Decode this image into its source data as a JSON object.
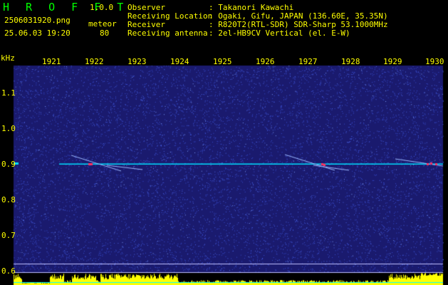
{
  "header": {
    "logo": "H R O F F T",
    "version": "1.0.0",
    "filename": "2506031920.png",
    "timestamp": "25.06.03 19:20",
    "meteor_label": "meteor",
    "meteor_count": "80",
    "info": [
      {
        "key": "Observer",
        "value": "Takanori Kawachi"
      },
      {
        "key": "Receiving Location",
        "value": "Ogaki, Gifu, JAPAN (136.60E, 35.35N)"
      },
      {
        "key": "Receiver",
        "value": "R820T2(RTL-SDR) SDR-Sharp 53.1000MHz"
      },
      {
        "key": "Receiving antenna",
        "value": "2el-HB9CV Vertical (el. E-W)"
      }
    ]
  },
  "chart_data": {
    "type": "heatmap",
    "ylabel": "kHz",
    "x_ticks": [
      "1921",
      "1922",
      "1923",
      "1924",
      "1925",
      "1926",
      "1927",
      "1928",
      "1929",
      "1930"
    ],
    "y_ticks": [
      "1.1",
      "1.0",
      "0.9",
      "0.8",
      "0.7",
      "0.6"
    ],
    "ylim": [
      0.6,
      1.1
    ],
    "carrier_khz": 0.9,
    "colors": {
      "background": "#1a1a6e",
      "noise": "#3a4fd0",
      "carrier": "#00e0ff",
      "echo": "#ff3060",
      "text": "#ffff00",
      "logo": "#00ff00",
      "level": "#ffff00"
    }
  }
}
